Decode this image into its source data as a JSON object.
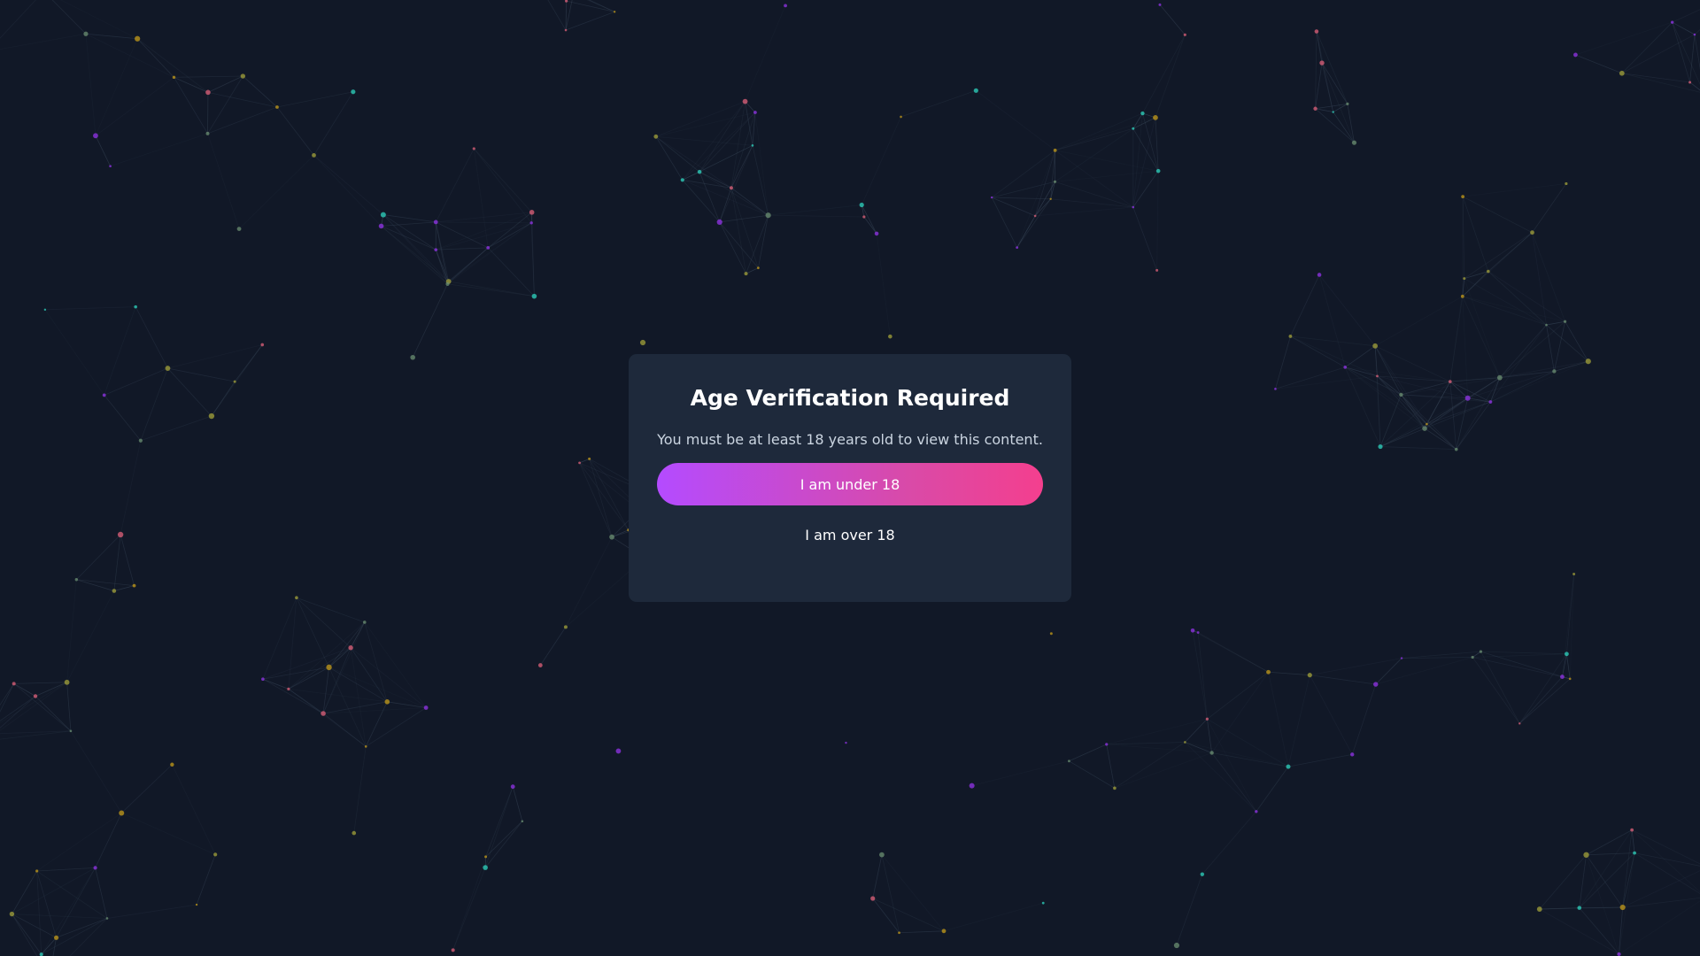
{
  "modal": {
    "title": "Age Verification Required",
    "message": "You must be at least 18 years old to view this content.",
    "under_button_label": "I am under 18",
    "over_button_label": "I am over 18"
  },
  "colors": {
    "background": "#111827",
    "modal_background": "#1e293b",
    "button_gradient_start": "#b44bff",
    "button_gradient_end": "#f43f8e",
    "particle_colors": [
      "#2dd4bf",
      "#a3a23a",
      "#9333ea",
      "#e0607a",
      "#6b8f71",
      "#c49b18"
    ]
  }
}
